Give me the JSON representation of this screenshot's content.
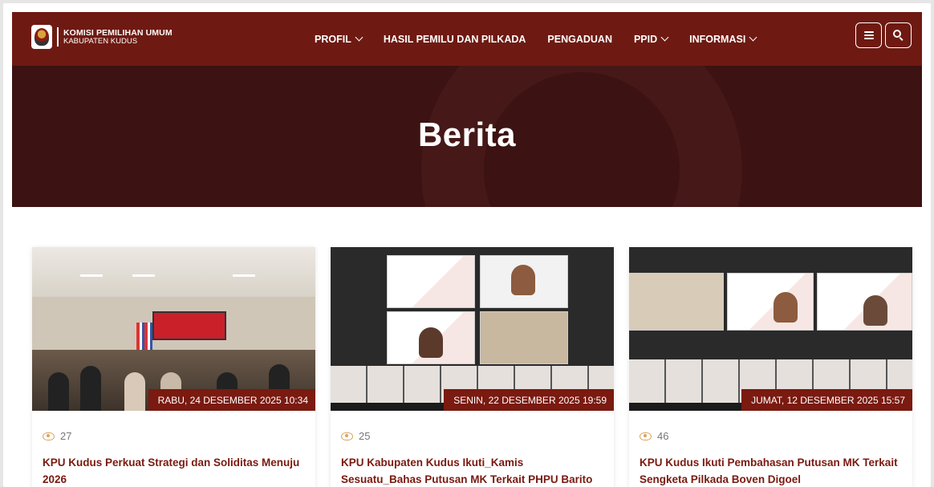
{
  "header": {
    "logo_line1": "KOMISI PEMILIHAN UMUM",
    "logo_line2": "KABUPATEN KUDUS",
    "menu": [
      {
        "label": "PROFIL",
        "dropdown": true
      },
      {
        "label": "HASIL PEMILU DAN PILKADA",
        "dropdown": false
      },
      {
        "label": "PENGADUAN",
        "dropdown": false
      },
      {
        "label": "PPID",
        "dropdown": true
      },
      {
        "label": "INFORMASI",
        "dropdown": true
      }
    ],
    "menu_icon": "hamburger-icon",
    "search_icon": "search-icon"
  },
  "hero": {
    "title": "Berita"
  },
  "cards": [
    {
      "date": "RABU, 24 DESEMBER 2025 10:34",
      "views": "27",
      "title": "KPU Kudus Perkuat Strategi dan Soliditas Menuju 2026",
      "image": "meeting-room-photo"
    },
    {
      "date": "SENIN, 22 DESEMBER 2025 19:59",
      "views": "25",
      "title": "KPU Kabupaten Kudus Ikuti_Kamis Sesuatu_Bahas Putusan MK Terkait PHPU Barito Utara",
      "image": "zoom-meeting-screenshot"
    },
    {
      "date": "JUMAT, 12 DESEMBER 2025 15:57",
      "views": "46",
      "title": "KPU Kudus Ikuti Pembahasan Putusan MK Terkait Sengketa Pilkada Boven Digoel",
      "image": "zoom-meeting-screenshot"
    }
  ],
  "colors": {
    "navbar": "#6e1a12",
    "hero": "#3c1212",
    "accent": "#7a1a10",
    "eye_icon": "#d9a35a"
  }
}
